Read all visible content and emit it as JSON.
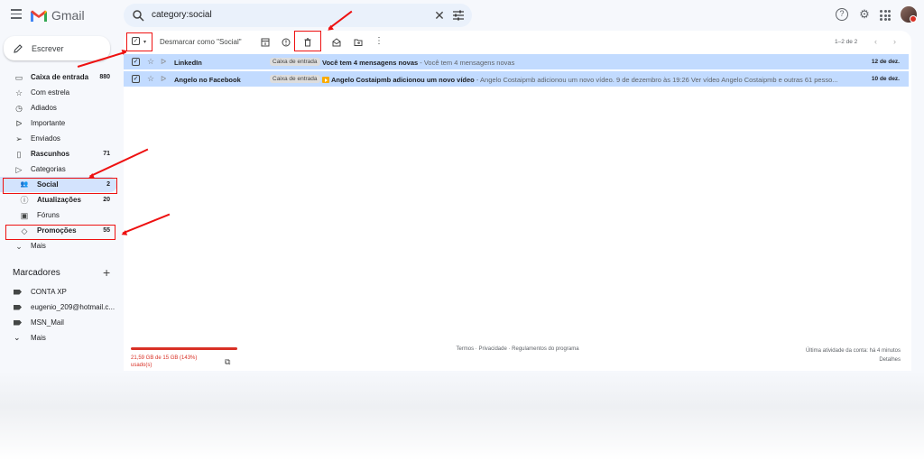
{
  "app": {
    "name": "Gmail"
  },
  "search": {
    "query": "category:social"
  },
  "compose": {
    "label": "Escrever"
  },
  "nav": [
    {
      "icon": "inbox-icon",
      "label": "Caixa de entrada",
      "count": "880",
      "bold": true
    },
    {
      "icon": "star-icon",
      "label": "Com estrela",
      "count": ""
    },
    {
      "icon": "clock-icon",
      "label": "Adiados",
      "count": ""
    },
    {
      "icon": "important-icon",
      "label": "Importante",
      "count": ""
    },
    {
      "icon": "send-icon",
      "label": "Enviados",
      "count": ""
    },
    {
      "icon": "draft-icon",
      "label": "Rascunhos",
      "count": "71",
      "bold": true
    },
    {
      "icon": "label-icon",
      "label": "Categorias",
      "count": ""
    },
    {
      "icon": "people-icon",
      "label": "Social",
      "count": "2",
      "bold": true,
      "sub": true,
      "selected": true
    },
    {
      "icon": "info-icon",
      "label": "Atualizações",
      "count": "20",
      "bold": true,
      "sub": true
    },
    {
      "icon": "forum-icon",
      "label": "Fóruns",
      "count": "",
      "sub": true
    },
    {
      "icon": "tag-icon",
      "label": "Promoções",
      "count": "55",
      "bold": true,
      "sub": true
    },
    {
      "icon": "chevron-down-icon",
      "label": "Mais",
      "count": ""
    }
  ],
  "labels": {
    "title": "Marcadores",
    "items": [
      "CONTA XP",
      "eugenio_209@hotmail.c...",
      "MSN_Mail"
    ],
    "more": "Mais"
  },
  "toolbar": {
    "deselect_label": "Desmarcar como \"Social\"",
    "pager": "1–2 de 2"
  },
  "emails": [
    {
      "sender": "LinkedIn",
      "badge": "Caixa de entrada",
      "subject": "Você tem 4 mensagens novas",
      "snippet": " - Você tem 4 mensagens novas",
      "date": "12 de dez.",
      "youtube": false
    },
    {
      "sender": "Angelo no Facebook",
      "badge": "Caixa de entrada",
      "subject": "Angelo Costaipmb adicionou um novo vídeo",
      "snippet": " - Angelo Costaipmb adicionou um novo vídeo. 9 de dezembro às 19:26 Ver vídeo Angelo Costaipmb e outras 61 pesso...",
      "date": "10 de dez.",
      "youtube": true
    }
  ],
  "storage": {
    "text": "21,59 GB de 15 GB (143%) usado(s)",
    "used_fraction": 1.0
  },
  "footer": {
    "links": "Termos · Privacidade · Regulamentos do programa",
    "activity": "Última atividade da conta: há 4 minutos",
    "details": "Detalhes"
  },
  "colors": {
    "accent_red": "#d93025",
    "selected_row": "#c2dbff",
    "annotation": "#ee1111"
  }
}
